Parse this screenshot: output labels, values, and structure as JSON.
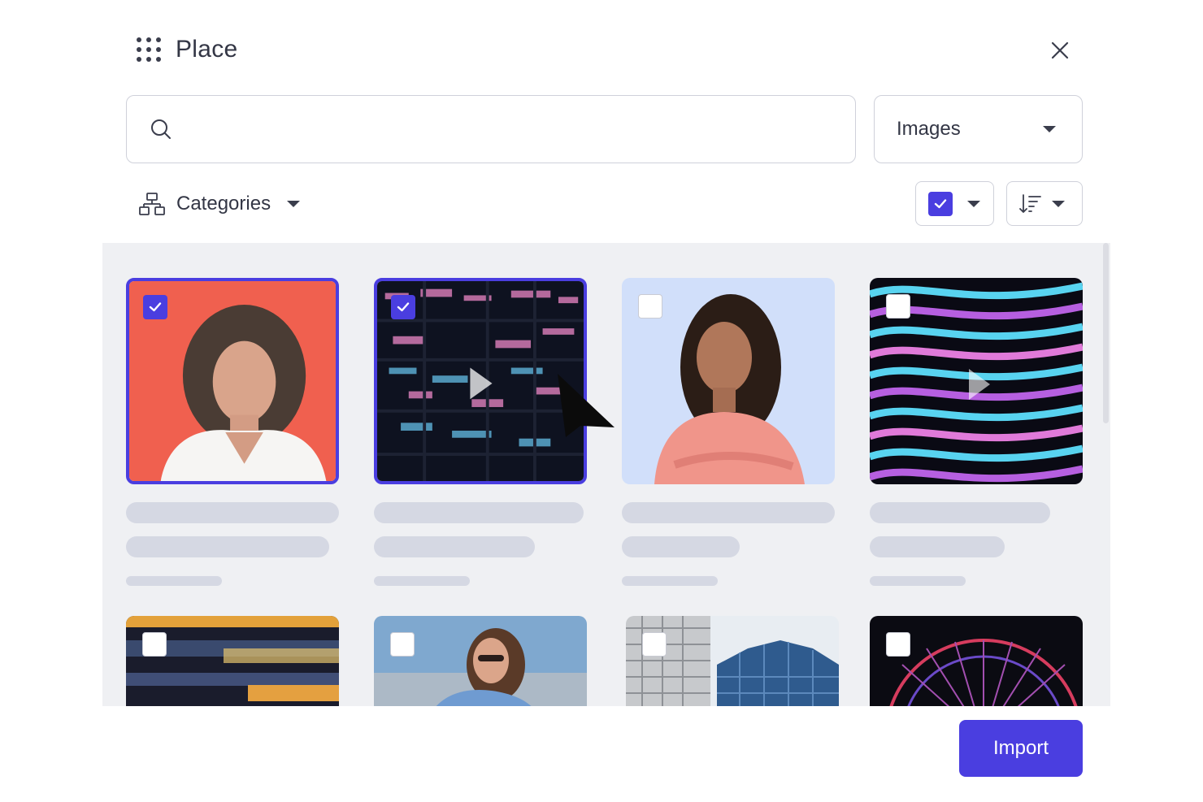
{
  "dialog": {
    "title": "Place",
    "grip_icon": "grip-dots-icon",
    "close_icon": "close-icon"
  },
  "search": {
    "value": "",
    "placeholder": "",
    "icon": "search-icon"
  },
  "type_filter": {
    "selected": "Images"
  },
  "categories": {
    "label": "Categories",
    "icon": "hierarchy-icon"
  },
  "toolbar": {
    "select_all_icon": "checkbox-checked-icon",
    "sort_icon": "sort-descending-icon"
  },
  "assets": [
    {
      "name": "woman-gray-curly-hair-red-background",
      "selected": true,
      "video": false
    },
    {
      "name": "office-building-at-night",
      "selected": true,
      "video": true
    },
    {
      "name": "smiling-woman-pink-sweater",
      "selected": false,
      "video": false
    },
    {
      "name": "abstract-neon-waves",
      "selected": false,
      "video": true
    },
    {
      "name": "blurred-city-lights",
      "selected": false,
      "video": false
    },
    {
      "name": "woman-with-sunglasses-sky",
      "selected": false,
      "video": false
    },
    {
      "name": "glass-skyscrapers",
      "selected": false,
      "video": false
    },
    {
      "name": "neon-ferris-wheel",
      "selected": false,
      "video": false
    }
  ],
  "footer": {
    "import_label": "Import"
  },
  "colors": {
    "accent": "#4a3ee0",
    "gallery_bg": "#eff0f3",
    "skeleton": "#d5d8e3"
  }
}
